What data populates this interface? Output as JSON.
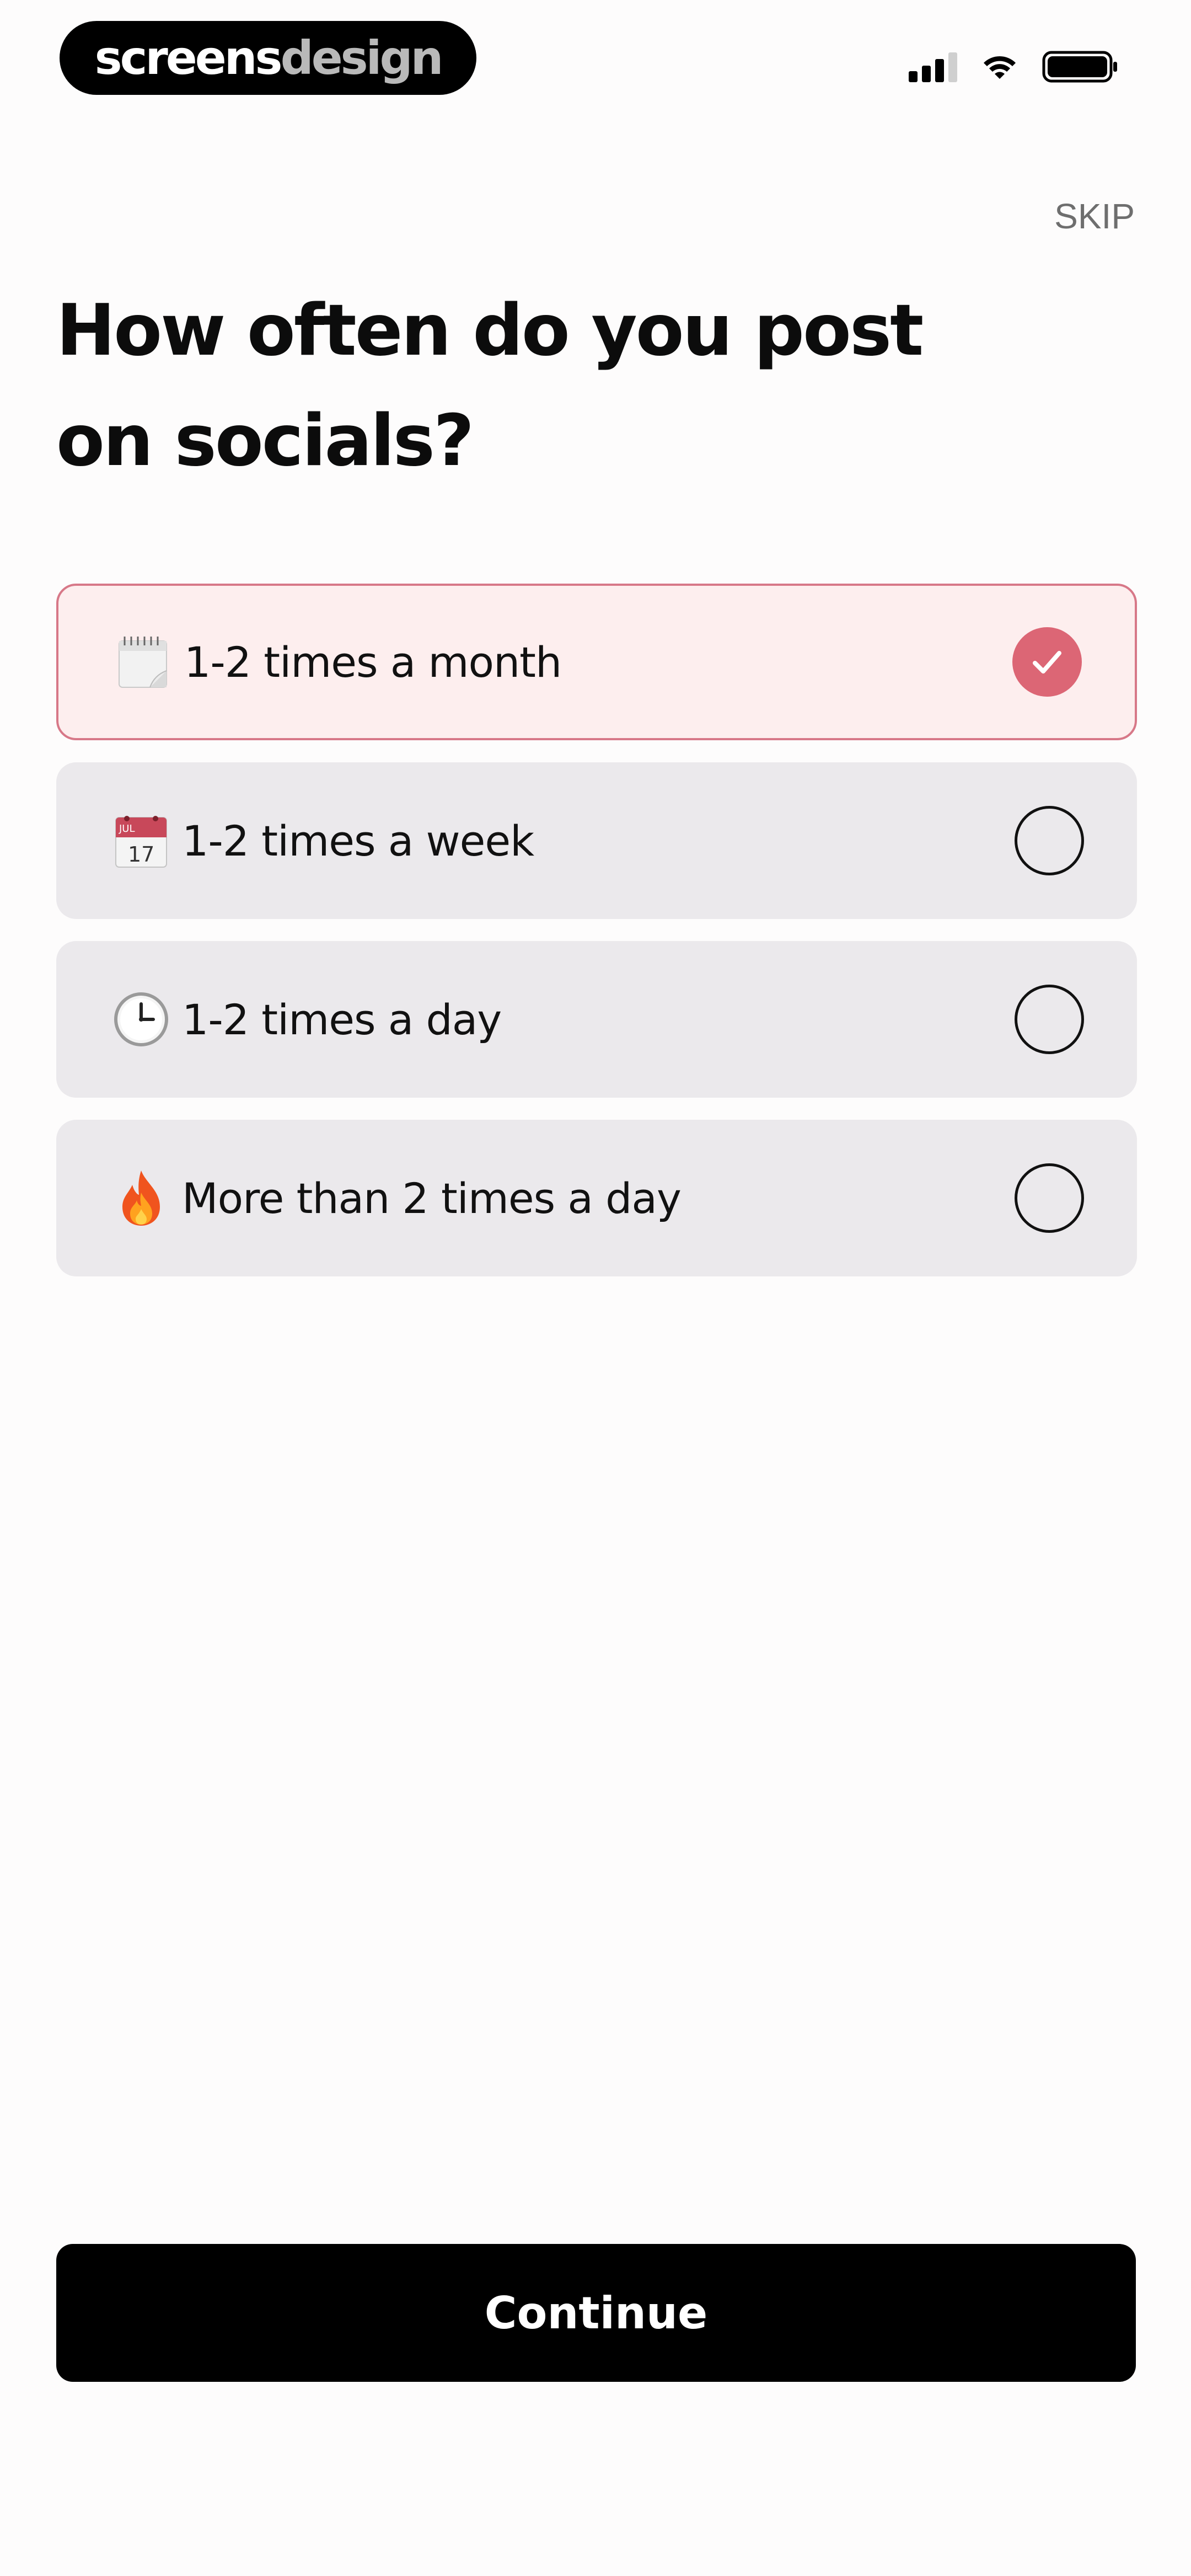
{
  "brand": {
    "part1": "screens",
    "part2": "design"
  },
  "status_bar": {
    "signal_icon": "signal-icon",
    "wifi_icon": "wifi-icon",
    "battery_icon": "battery-icon"
  },
  "header": {
    "skip_label": "SKIP"
  },
  "question": {
    "line1": "How often do you post",
    "line2": "on socials?"
  },
  "options": [
    {
      "emoji_icon": "spiral-calendar-icon",
      "label": "1-2 times a month",
      "selected": true
    },
    {
      "emoji_icon": "tear-off-calendar-icon",
      "emoji_text_top": "JUL",
      "emoji_text_num": "17",
      "label": "1-2 times a week",
      "selected": false
    },
    {
      "emoji_icon": "clock-icon",
      "label": "1-2 times a day",
      "selected": false
    },
    {
      "emoji_icon": "fire-icon",
      "label": "More than 2 times a day",
      "selected": false
    }
  ],
  "footer": {
    "continue_label": "Continue"
  },
  "colors": {
    "accent": "#dc6675",
    "selected_bg": "#fdeeee",
    "selected_border": "#d77888",
    "option_bg": "#ebe9ec",
    "button_bg": "#000000"
  }
}
